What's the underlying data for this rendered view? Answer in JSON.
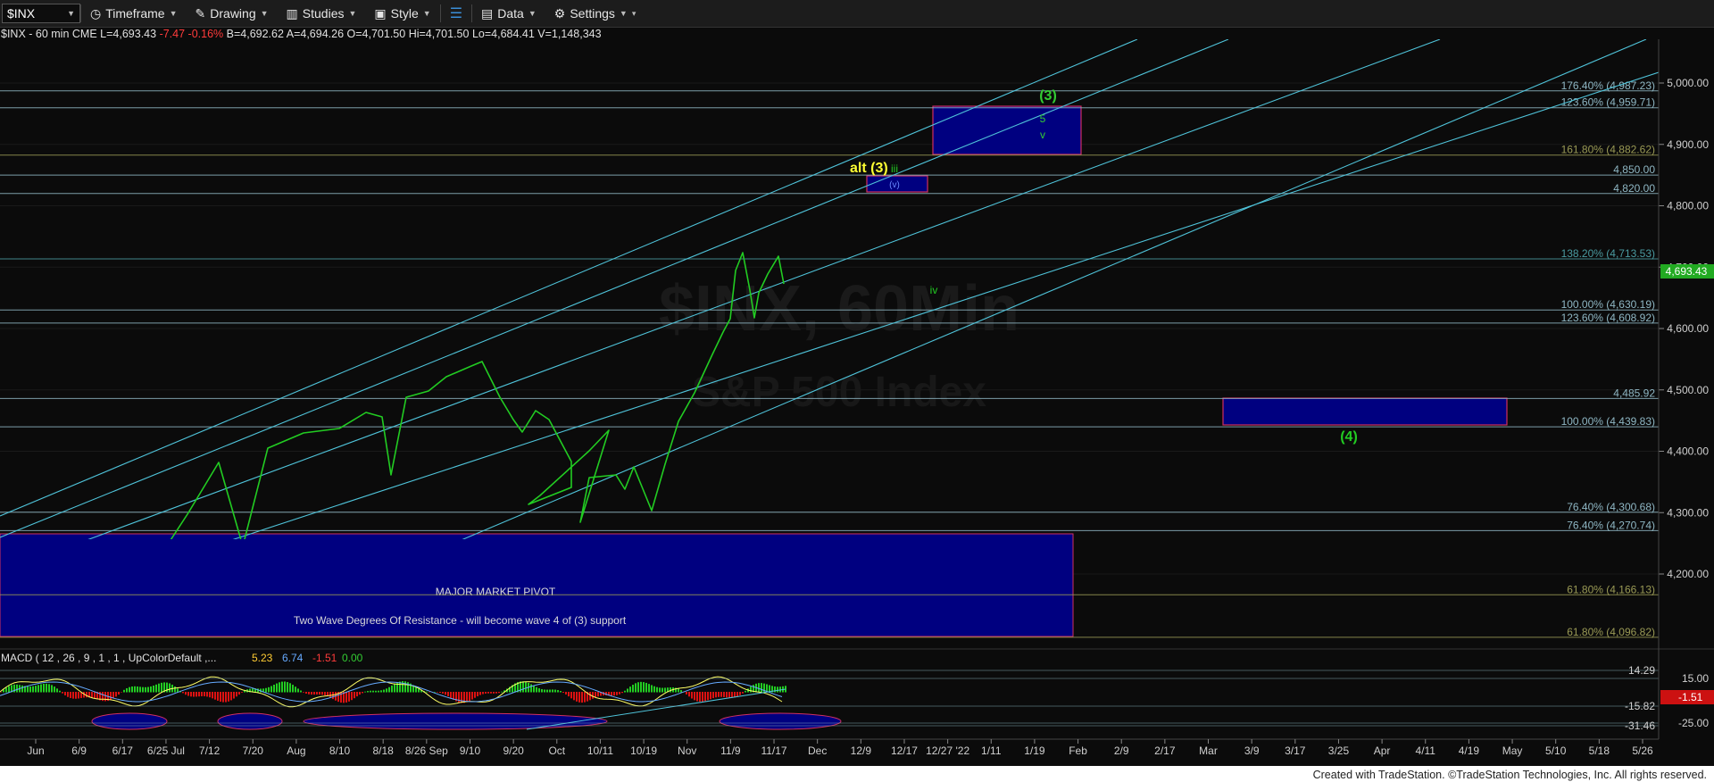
{
  "toolbar": {
    "symbol": "$INX",
    "timeframe": "Timeframe",
    "drawing": "Drawing",
    "studies": "Studies",
    "style": "Style",
    "data": "Data",
    "settings": "Settings"
  },
  "info": {
    "symbol": "$INX - 60 min  CME",
    "last": "L=4,693.43",
    "chg": "-7.47",
    "pct": "-0.16%",
    "bid": "B=4,692.62",
    "ask": "A=4,694.26",
    "open": "O=4,701.50",
    "hi": "Hi=4,701.50",
    "lo": "Lo=4,684.41",
    "vol": "V=1,148,343"
  },
  "watermark": {
    "line1": "$INX, 60Min",
    "line2": "S&P 500 Index"
  },
  "price_axis": [
    "5,000.00",
    "4,900.00",
    "4,800.00",
    "4,700.00",
    "4,600.00",
    "4,500.00",
    "4,400.00",
    "4,300.00",
    "4,200.00"
  ],
  "current_price": "4,693.43",
  "levels": [
    {
      "label": "176.40% (4,987.23)",
      "color": "#8fb7c4"
    },
    {
      "label": "123.60% (4,959.71)",
      "color": "#8fb7c4"
    },
    {
      "label": "161.80% (4,882.62)",
      "color": "#9a9a55"
    },
    {
      "label": "4,850.00",
      "color": "#8fb7c4"
    },
    {
      "label": "4,820.00",
      "color": "#8fb7c4"
    },
    {
      "label": "138.20% (4,713.53)",
      "color": "#4a9aa0"
    },
    {
      "label": "100.00% (4,630.19)",
      "color": "#8fb7c4"
    },
    {
      "label": "123.60% (4,608.92)",
      "color": "#8fb7c4"
    },
    {
      "label": "4,485.92",
      "color": "#8fb7c4"
    },
    {
      "label": "100.00% (4,439.83)",
      "color": "#8fb7c4"
    },
    {
      "label": "76.40% (4,300.68)",
      "color": "#8fb7c4"
    },
    {
      "label": "76.40% (4,270.74)",
      "color": "#8fb7c4"
    },
    {
      "label": "61.80% (4,166.13)",
      "color": "#9a9a55"
    },
    {
      "label": "61.80% (4,096.82)",
      "color": "#9a9a55"
    }
  ],
  "annotations": {
    "pivot_title": "MAJOR MARKET PIVOT",
    "pivot_note": "Two Wave Degrees Of Resistance - will become wave 4 of (3) support",
    "alt3": "alt (3)",
    "wave3": "(3)",
    "wave4": "(4)",
    "iii": "iii",
    "iv": "iv",
    "five": "5",
    "v": "v",
    "v_paren": "(v)"
  },
  "macd": {
    "label": "MACD ( 12 , 26 , 9 , 1 , 1 , UpColorDefault ,...",
    "v1": "5.23",
    "v2": "6.74",
    "v3": "-1.51",
    "v4": "0.00",
    "axis": [
      "14.29",
      "15.00",
      "-15.82",
      "-25.00",
      "-31.46"
    ],
    "current": "-1.51"
  },
  "time_axis": [
    "Jun",
    "6/9",
    "6/17",
    "6/25 Jul",
    "7/12",
    "7/20",
    "Aug",
    "8/10",
    "8/18",
    "8/26 Sep",
    "9/10",
    "9/20",
    "Oct",
    "10/11",
    "10/19",
    "Nov",
    "11/9",
    "11/17",
    "Dec",
    "12/9",
    "12/17",
    "12/27 '22",
    "1/11",
    "1/19",
    "Feb",
    "2/9",
    "2/17",
    "Mar",
    "3/9",
    "3/17",
    "3/25",
    "Apr",
    "4/11",
    "4/19",
    "May",
    "5/10",
    "5/18",
    "5/26"
  ],
  "footer": "Created with TradeStation. ©TradeStation Technologies, Inc. All rights reserved.",
  "colors": {
    "up": "#22cc22",
    "wave": "#33cc33",
    "yellow": "#ffff33",
    "channel": "#4fc3d9",
    "box": "#00007f"
  }
}
